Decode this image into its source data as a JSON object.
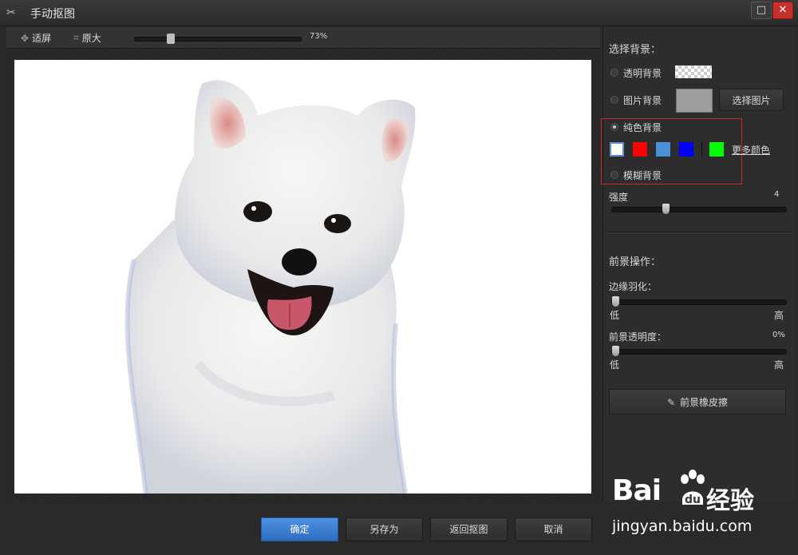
{
  "window": {
    "title": "手动抠图"
  },
  "toolbar": {
    "fit_label": "适屏",
    "original_label": "原大",
    "zoom_value": "73%",
    "zoom_fraction": 0.2
  },
  "panel": {
    "bg_heading": "选择背景：",
    "transparent_bg": "透明背景",
    "image_bg": "图片背景",
    "choose_image_btn": "选择图片",
    "solid_bg": "纯色背景",
    "more_colors": "更多颜色",
    "blur_bg": "模糊背景",
    "strength_label": "强度",
    "strength_value": "4",
    "strength_fraction": 0.3,
    "fg_heading": "前景操作：",
    "feather_label": "边缘羽化：",
    "low": "低",
    "high": "高",
    "feather_fraction": 0.0,
    "opacity_label": "前景透明度：",
    "opacity_value": "0%",
    "opacity_fraction": 0.0,
    "eraser_btn": "前景橡皮擦",
    "selected_background": "纯色背景",
    "colors": [
      "#ffffff",
      "#ff0000",
      "#4a90d9",
      "#0000ff",
      "#00ff00"
    ]
  },
  "bottom": {
    "ok": "确定",
    "save_as": "另存为",
    "back": "返回抠图",
    "cancel": "取消"
  },
  "watermark": {
    "logo": "Bai",
    "logo_cn": "经验",
    "url": "jingyan.baidu.com"
  }
}
